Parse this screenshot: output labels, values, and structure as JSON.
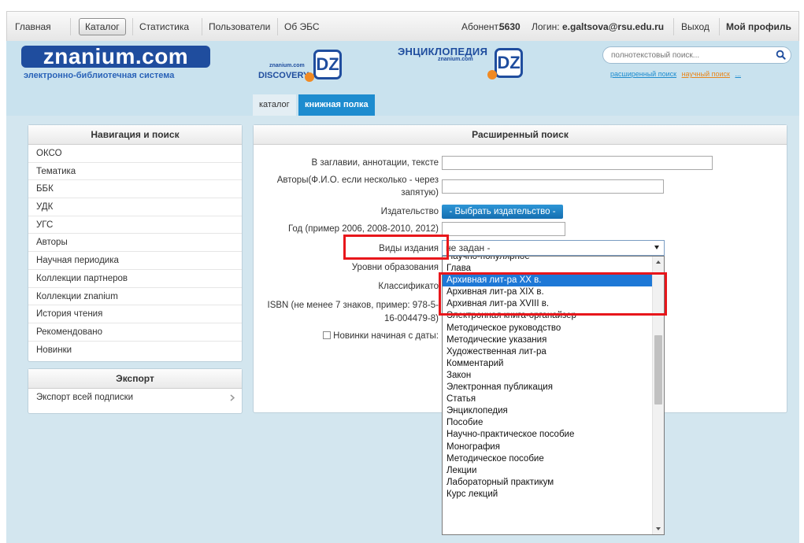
{
  "topnav": {
    "home": "Главная",
    "catalog": "Каталог",
    "stats": "Статистика",
    "users": "Пользователи",
    "about": "Об ЭБС",
    "subscriber_label": "Абонент:",
    "subscriber_id": "5630",
    "login_label": "Логин:",
    "login_value": "e.galtsova@rsu.edu.ru",
    "logout": "Выход",
    "profile": "Мой профиль"
  },
  "header": {
    "logo": "znanium.com",
    "logo_subtitle": "электронно-библиотечная система",
    "discovery_small": "znanium.com",
    "discovery_big": "DISCOVERY",
    "dz_letters": "DZ",
    "encyclopedia_title": "ЭНЦИКЛОПЕДИЯ",
    "encyclopedia_small": "znanium.com",
    "search_placeholder": "полнотекстовый поиск...",
    "advanced_search": "расширенный поиск",
    "scientific_search": "научный поиск",
    "more_link": "..."
  },
  "tabs": {
    "catalog": "каталог",
    "shelf": "книжная полка"
  },
  "navigation": {
    "title": "Навигация и поиск",
    "items": [
      "ОКСО",
      "Тематика",
      "ББК",
      "УДК",
      "УГС",
      "Авторы",
      "Научная периодика",
      "Коллекции партнеров",
      "Коллекции znanium",
      "История чтения",
      "Рекомендовано",
      "Новинки"
    ]
  },
  "export": {
    "title": "Экспорт",
    "item": "Экспорт всей подписки"
  },
  "advanced": {
    "title": "Расширенный поиск",
    "in_title_label": "В заглавии, аннотации, тексте",
    "authors_label_1": "Авторы(Ф.И.О. если несколько - через",
    "authors_label_2": "запятую)",
    "publisher_label": "Издательство",
    "publisher_button": "- Выбрать издательство -",
    "year_label": "Год (пример 2006, 2008-2010, 2012)",
    "type_label": "Виды издания",
    "type_selected": "не задан -",
    "education_label": "Уровни образования",
    "classifier_label": "Классификато",
    "isbn_label_1": "ISBN (не менее 7 знаков, пример: 978-5-",
    "isbn_label_2": "16-004479-8)",
    "new_since_label": "Новинки начиная с даты:"
  },
  "dropdown_options": [
    "Научно-популярное",
    "Глава",
    "Архивная лит-ра XX в.",
    "Архивная лит-ра XIX в.",
    "Архивная лит-ра XVIII в.",
    "Электронная книга-органайзер",
    "Методическое руководство",
    "Методические указания",
    "Художественная лит-ра",
    "Комментарий",
    "Закон",
    "Электронная публикация",
    "Статья",
    "Энциклопедия",
    "Пособие",
    "Научно-практическое пособие",
    "Монография",
    "Методическое пособие",
    "Лекции",
    "Лабораторный практикум",
    "Курс лекций"
  ],
  "dropdown_selected_index": 2,
  "colors": {
    "brand": "#1f4d9e",
    "accent": "#1d8ccf",
    "highlight": "#e8161b",
    "selected": "#1e78d6"
  }
}
